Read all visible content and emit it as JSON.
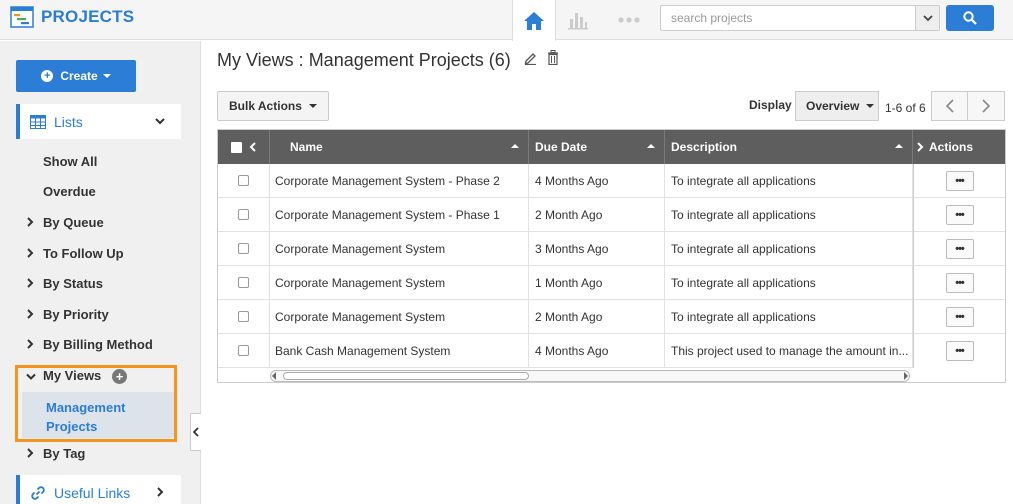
{
  "header": {
    "app_title": "PROJECTS",
    "search_placeholder": "search projects"
  },
  "sidebar": {
    "create_label": "Create",
    "lists_label": "Lists",
    "items": [
      {
        "label": "Show All",
        "has_arrow": false
      },
      {
        "label": "Overdue",
        "has_arrow": false
      },
      {
        "label": "By Queue",
        "has_arrow": true
      },
      {
        "label": "To Follow Up",
        "has_arrow": true
      },
      {
        "label": "By Status",
        "has_arrow": true
      },
      {
        "label": "By Priority",
        "has_arrow": true
      },
      {
        "label": "By Billing Method",
        "has_arrow": true
      }
    ],
    "my_views_label": "My Views",
    "my_views_sub": "Management Projects",
    "by_tag_label": "By Tag",
    "useful_links_label": "Useful Links"
  },
  "main": {
    "title": "My Views : Management Projects (6)",
    "bulk_actions_label": "Bulk Actions",
    "display_label": "Display",
    "display_value": "Overview",
    "page_range": "1-6 of 6",
    "columns": {
      "name": "Name",
      "due_date": "Due Date",
      "description": "Description",
      "actions": "Actions"
    },
    "rows": [
      {
        "name": "Corporate Management System - Phase 2",
        "due": "4 Months Ago",
        "desc": "To integrate all applications"
      },
      {
        "name": "Corporate Management System - Phase 1",
        "due": "2 Month Ago",
        "desc": "To integrate all applications"
      },
      {
        "name": "Corporate Management System",
        "due": "3 Months Ago",
        "desc": "To integrate all applications"
      },
      {
        "name": "Corporate Management System",
        "due": "1 Month Ago",
        "desc": "To integrate all applications"
      },
      {
        "name": "Corporate Management System",
        "due": "2 Month Ago",
        "desc": "To integrate all applications"
      },
      {
        "name": "Bank Cash Management System",
        "due": "4 Months Ago",
        "desc": "This project used to manage the amount in..."
      }
    ],
    "row_action_label": "•••"
  },
  "colors": {
    "accent": "#2b7dd6",
    "highlight": "#f7941d",
    "header_bg": "#5e5e5e"
  },
  "icons": {
    "brand": "projects-app-icon",
    "home": "home-icon",
    "chart": "bar-chart-icon",
    "more": "more-dots-icon",
    "search": "search-icon",
    "edit": "pencil-icon",
    "delete": "trash-icon"
  }
}
